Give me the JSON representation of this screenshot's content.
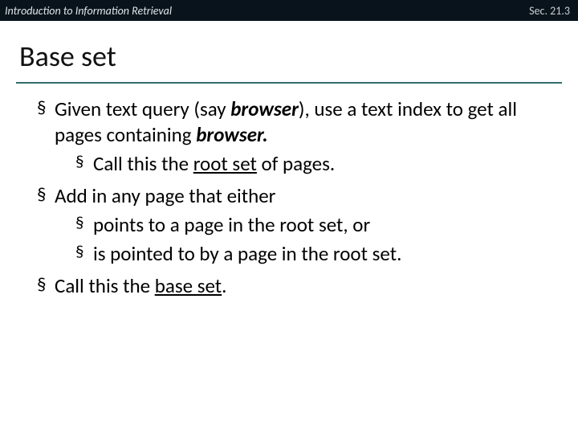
{
  "topbar": {
    "left": "Introduction to Information Retrieval",
    "right": "Sec. 21.3"
  },
  "title": "Base set",
  "b1": {
    "pre": "Given text query (say ",
    "em1": "browser",
    "mid": "), use a text index to get all pages containing ",
    "em2": "browser.",
    "sub": {
      "pre": "Call this the ",
      "u": "root set",
      "post": " of pages."
    }
  },
  "b2": {
    "text": "Add in any page that either",
    "sub1": "points to a page in the root set, or",
    "sub2": "is pointed to by a page in the root set."
  },
  "b3": {
    "pre": "Call this the ",
    "u": "base set",
    "post": "."
  }
}
